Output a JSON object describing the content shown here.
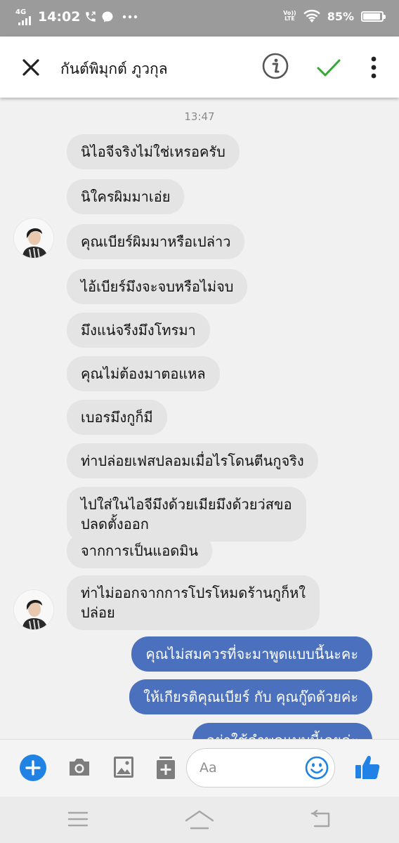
{
  "status_bar": {
    "network": "4G",
    "time": "14:02",
    "volte": "Vo LTE",
    "battery_percent": "85%",
    "battery_level": 0.85,
    "icons": [
      "signal-icon",
      "phone-call-icon",
      "chat-icon",
      "more-dots-icon",
      "volte-icon",
      "wifi-icon",
      "battery-icon"
    ]
  },
  "header": {
    "contact_name": "กันต์พิมุกต์ ภูวกุล",
    "icons": [
      "close-icon",
      "info-icon",
      "checkmark-icon",
      "more-vertical-icon"
    ],
    "accent_check": "#33a833"
  },
  "chat": {
    "timestamp": "13:47",
    "incoming_bubble_color": "#e4e4e4",
    "outgoing_bubble_color": "#4b70be",
    "messages": [
      {
        "dir": "in",
        "text": "นิไอจีจริงไม่ใช่เหรอครับ"
      },
      {
        "dir": "in",
        "text": "นิใครผิมมาเอ่ย"
      },
      {
        "dir": "in",
        "text": "คุณเบียร์ผิมมาหรือเปล่าว"
      },
      {
        "dir": "in",
        "text": "ไอ้เบียร์มึงจะจบหรือไม่จบ"
      },
      {
        "dir": "in",
        "text": "มึงแน่จรีงมึงโทรมา"
      },
      {
        "dir": "in",
        "text": "คุณไม่ต้องมาตอแหล"
      },
      {
        "dir": "in",
        "text": "เบอรมึงกูก็มี"
      },
      {
        "dir": "in",
        "text": "ท่าปล่อยเฟสปลอมเมื่อไรโดนตีนกูจริง"
      },
      {
        "dir": "in",
        "line1": "ไปใส่ในไอจีมึงด้วยเมียมึงด้วยว่สขอ",
        "line2": "ปลดตั้งออก"
      },
      {
        "dir": "in",
        "text": "จากการเป็นแอดมิน"
      },
      {
        "dir": "in",
        "line1": "ท่าไม่ออกจากการโปรโหมดร้านกูก็หใ",
        "line2": "ปล่อย"
      },
      {
        "dir": "out",
        "text": "คุณไม่สมควรที่จะมาพูดแบบนี้นะคะ"
      },
      {
        "dir": "out",
        "text": "ให้เกียรติคุณเบียร์ กับ คุณกู๊ดด้วยค่ะ"
      },
      {
        "dir": "out",
        "text": "อย่าใช้คำพูดแบบนี้เลยค่ะ"
      }
    ]
  },
  "composer": {
    "placeholder": "Aa",
    "icons": [
      "plus-icon",
      "camera-icon",
      "gallery-icon",
      "sticker-icon",
      "emoji-icon",
      "like-icon"
    ],
    "accent": "#1f82e4"
  },
  "nav_bar": {
    "icons": [
      "menu-icon",
      "home-icon",
      "back-icon"
    ]
  }
}
